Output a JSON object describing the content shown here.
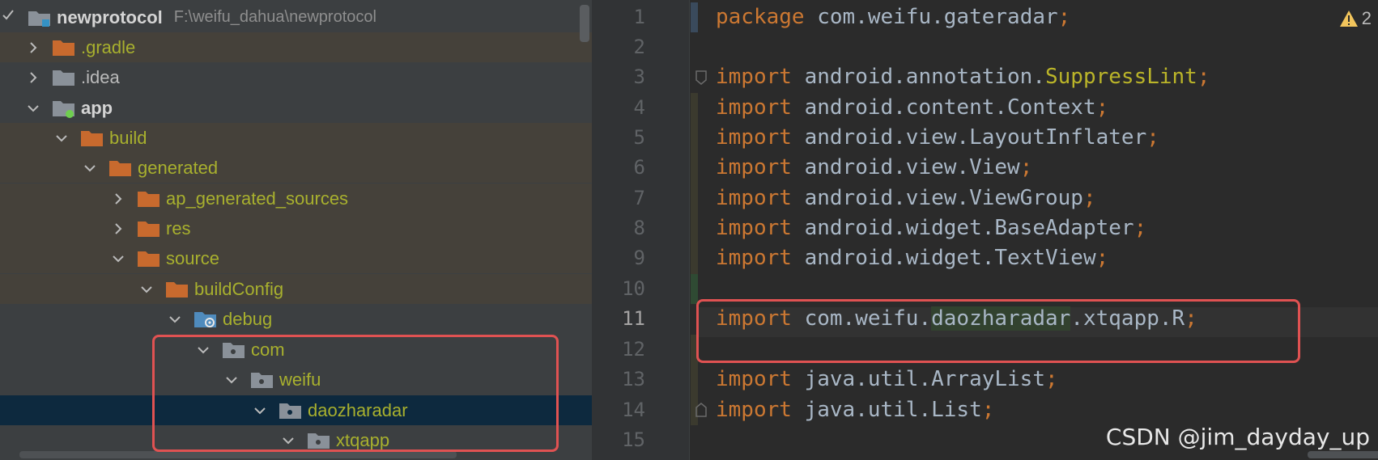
{
  "project_tree": {
    "root": {
      "label": "newprotocol",
      "path": "F:\\weifu_dahua\\newprotocol"
    },
    "items": [
      {
        "label": ".gradle"
      },
      {
        "label": ".idea"
      },
      {
        "label": "app"
      },
      {
        "label": "build"
      },
      {
        "label": "generated"
      },
      {
        "label": "ap_generated_sources"
      },
      {
        "label": "res"
      },
      {
        "label": "source"
      },
      {
        "label": "buildConfig"
      },
      {
        "label": "debug"
      },
      {
        "label": "com"
      },
      {
        "label": "weifu"
      },
      {
        "label": "daozharadar"
      },
      {
        "label": "xtqapp"
      }
    ]
  },
  "editor": {
    "line_numbers": [
      "1",
      "2",
      "3",
      "4",
      "5",
      "6",
      "7",
      "8",
      "9",
      "10",
      "11",
      "12",
      "13",
      "14",
      "15"
    ],
    "active_line": "11",
    "warning_count": "2",
    "kw_package": "package",
    "kw_import": "import",
    "semicolon": ";",
    "lines": {
      "l1": "com.weifu.gateradar",
      "l3_prefix": "android.annotation.",
      "l3_ann": "SuppressLint",
      "l4": "android.content.Context",
      "l5": "android.view.LayoutInflater",
      "l6": "android.view.View",
      "l7": "android.view.ViewGroup",
      "l8": "android.widget.BaseAdapter",
      "l9": "android.widget.TextView",
      "l11_prefix": "com.weifu.",
      "l11_hl": "daozharadar",
      "l11_suffix": ".xtqapp.R",
      "l13": "java.util.ArrayList",
      "l14": "java.util.List"
    }
  },
  "watermark": "CSDN @jim_dayday_up",
  "colors": {
    "keyword": "#cc7832",
    "annotation": "#bbb529",
    "default_text": "#a9b7c6",
    "tree_label_excluded": "#a8b02e",
    "highlight_box": "#e05252",
    "tree_bg": "#3c3f41",
    "editor_bg": "#2b2b2b"
  }
}
